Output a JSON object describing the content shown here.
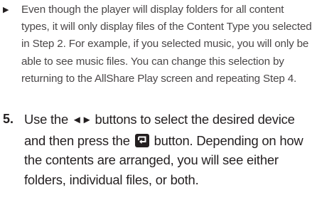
{
  "bullet": {
    "marker": "▶",
    "text": "Even though the player will display folders for all content types, it will only display files of the Content Type you selected in Step 2. For example, if you selected music, you will only be able to see music files. You can change this selection by returning to the AllShare Play screen and repeating Step 4."
  },
  "step": {
    "number": "5.",
    "text_part1": "Use the ",
    "arrows": "◄►",
    "text_part2": " buttons to select the desired device and then press the ",
    "enter_icon": "enter-button-icon",
    "text_part3": " button. Depending on how the contents are arranged, you will see either folders, individual files, or both."
  }
}
